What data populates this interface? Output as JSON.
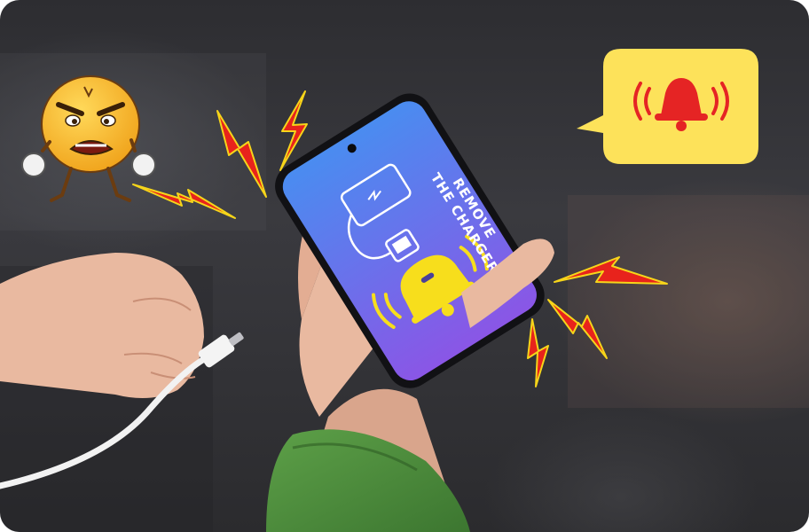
{
  "phone_screen": {
    "line1": "REMOVE",
    "line2": "THE CHARGER"
  },
  "colors": {
    "screen_top": "#4a8cf0",
    "screen_bottom": "#8a56e6",
    "bell_yellow": "#f7de1c",
    "bubble_yellow": "#fde25a",
    "alert_red": "#e52424",
    "lightning_red": "#e8231c",
    "lightning_outline": "#f6d51a",
    "sleeve_green": "#4a8a3a",
    "skin": "#e9b9a0"
  },
  "icons": {
    "bubble_icon": "ringing-bell-icon",
    "screen_icon": "ringing-bell-icon",
    "character": "angry-emoji-character"
  }
}
